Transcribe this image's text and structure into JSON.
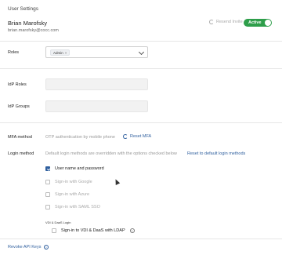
{
  "section_title": "User Settings",
  "user": {
    "name": "Brian Marofsky",
    "email": "brian.marofsky@cocc.com"
  },
  "header_actions": {
    "resend_invite": "Resend Invite",
    "status": "Active"
  },
  "roles": {
    "label": "Roles",
    "selected_chip": "Admin",
    "chip_remove": "×"
  },
  "idp_roles": {
    "label": "IdP Roles",
    "value": ""
  },
  "idp_groups": {
    "label": "IdP Groups",
    "value": ""
  },
  "mfa": {
    "label": "MFA method",
    "value": "OTP authentication by mobile phone",
    "reset_label": "Reset MFA"
  },
  "login_method": {
    "label": "Login method",
    "note": "Default login methods are overridden with the options checked below",
    "reset_link": "Reset to default login methods",
    "options": [
      {
        "label": "User name and password",
        "checked": true,
        "enabled": true
      },
      {
        "label": "Sign-in with Google",
        "checked": false,
        "enabled": false
      },
      {
        "label": "Sign-in with Azure",
        "checked": false,
        "enabled": false
      },
      {
        "label": "Sign-in with SAML SSO",
        "checked": false,
        "enabled": false
      }
    ],
    "vdi_heading": "VDI & DaaS Login",
    "vdi_option": {
      "label": "Sign-in to VDI & DaaS with LDAP",
      "checked": false
    }
  },
  "revoke_link": "Revoke API Keys",
  "help_glyph": "?",
  "colors": {
    "accent": "#2f5f9e",
    "active": "#2e9e4a"
  }
}
